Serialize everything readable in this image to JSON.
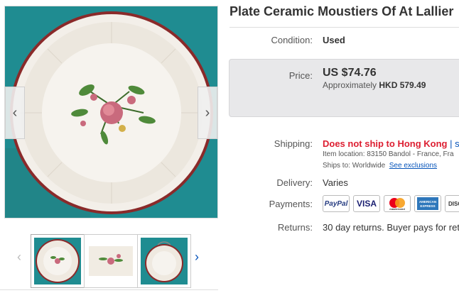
{
  "listing": {
    "title": "Plate Ceramic Moustiers Of At Lallier"
  },
  "gallery": {
    "prev_icon": "‹",
    "next_icon": "›",
    "thumb_prev": "‹",
    "thumb_next": "›"
  },
  "details": {
    "condition_label": "Condition:",
    "condition_value": "Used",
    "price_label": "Price:",
    "price_value": "US $74.76",
    "approx_prefix": "Approximately ",
    "approx_value": "HKD 579.49",
    "shipping_label": "Shipping:",
    "shipping_value": "Does not ship to Hong Kong",
    "shipping_sep": "| se",
    "item_location_label": "Item location:",
    "item_location_value": "83150 Bandol - France, Fra",
    "ships_to_label": "Ships to:",
    "ships_to_value": "Worldwide",
    "see_exclusions": "See exclusions",
    "delivery_label": "Delivery:",
    "delivery_value": "Varies",
    "payments_label": "Payments:",
    "returns_label": "Returns:",
    "returns_value": "30 day returns. Buyer pays for ret"
  },
  "payments": {
    "paypal": "PayPal",
    "visa": "VISA",
    "mastercard": "mastercard",
    "amex": "AMERICAN EXPRESS",
    "discover": "DISCO"
  },
  "colors": {
    "plate_background": "#1d8a8f",
    "plate_rim": "#8a2a2a",
    "price_box": "#e8e8ea",
    "ship_warning": "#dd1e31",
    "link": "#0654ba"
  }
}
